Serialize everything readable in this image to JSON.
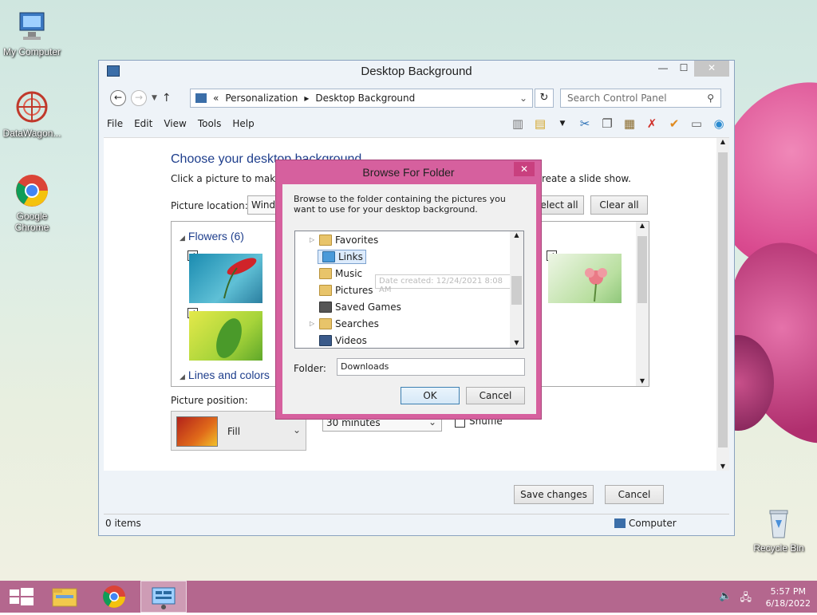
{
  "desktop": {
    "icons": [
      {
        "label": "My Computer",
        "icon": "computer-icon"
      },
      {
        "label": "DataWagon...",
        "icon": "datawagon-icon"
      },
      {
        "label": "Google Chrome",
        "icon": "chrome-icon"
      },
      {
        "label": "Recycle Bin",
        "icon": "recycle-bin-icon"
      }
    ]
  },
  "window": {
    "title": "Desktop Background",
    "controls": {
      "minimize": "—",
      "maximize": "☐",
      "close": "✕"
    },
    "breadcrumb": {
      "prefix": "«",
      "items": [
        "Personalization",
        "Desktop Background"
      ]
    },
    "search_placeholder": "Search Control Panel",
    "menu": [
      "File",
      "Edit",
      "View",
      "Tools",
      "Help"
    ],
    "heading": "Choose your desktop background",
    "subheading": "Click a picture to make it",
    "subheading_tail": "reate a slide show.",
    "picture_location_label": "Picture location:",
    "picture_location_value": "Windo",
    "select_all": "elect all",
    "clear_all": "Clear all",
    "groups": [
      {
        "label": "Flowers (6)"
      },
      {
        "label": "Lines and colors"
      }
    ],
    "picture_position_label": "Picture position:",
    "picture_position_value": "Fill",
    "interval_value": "30 minutes",
    "shuffle_label": "Shuffle",
    "save_changes": "Save changes",
    "cancel": "Cancel",
    "status_items": "0 items",
    "status_computer": "Computer"
  },
  "dialog": {
    "title": "Browse For Folder",
    "close": "✕",
    "instructions": "Browse to the folder containing the pictures you want to use for your desktop background.",
    "tree": [
      {
        "label": "Favorites",
        "expandable": true
      },
      {
        "label": "Links",
        "expandable": false,
        "selected": true
      },
      {
        "label": "Music",
        "expandable": false
      },
      {
        "label": "Pictures",
        "expandable": false
      },
      {
        "label": "Saved Games",
        "expandable": false
      },
      {
        "label": "Searches",
        "expandable": true
      },
      {
        "label": "Videos",
        "expandable": false
      }
    ],
    "tooltip": "Date created: 12/24/2021 8:08 AM",
    "folder_label": "Folder:",
    "folder_value": "Downloads",
    "ok": "OK",
    "cancel": "Cancel"
  },
  "taskbar": {
    "time": "5:57 PM",
    "date": "6/18/2022",
    "items": [
      "start-button",
      "file-explorer",
      "chrome",
      "control-panel"
    ]
  },
  "colors": {
    "accent": "#1e3e8c",
    "dialog_frame": "#d6609e",
    "taskbar": "#b4678e"
  }
}
